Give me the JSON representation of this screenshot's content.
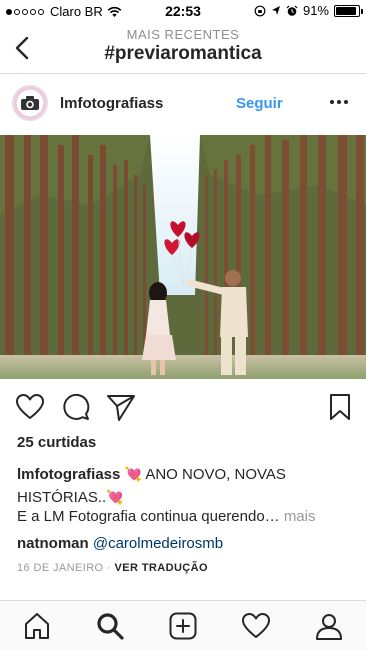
{
  "status_bar": {
    "carrier": "Claro BR",
    "time": "22:53",
    "battery": "91%",
    "battery_level": 0.91,
    "signal_dots_filled": 1,
    "signal_dots_total": 5
  },
  "nav": {
    "subtitle": "MAIS RECENTES",
    "title": "#previaromantica"
  },
  "post": {
    "username": "lmfotografiass",
    "follow_label": "Seguir",
    "likes": "25 curtidas",
    "caption": {
      "username": "lmfotografiass",
      "emoji": "💘",
      "text_line1": "ANO NOVO, NOVAS",
      "text_line2": "HISTÓRIAS..",
      "emoji2": "💘",
      "text_line3": "E a LM Fotografia continua querendo…",
      "more": "mais"
    },
    "comment": {
      "username": "natnoman",
      "mention": "@carolmedeirosmb"
    },
    "date": "16 DE JANEIRO",
    "separator": "·",
    "translate": "VER TRADUÇÃO"
  },
  "colors": {
    "link_blue": "#3897f0",
    "mention_blue": "#003569",
    "muted": "#999999",
    "text": "#262626",
    "divider": "#dbdbdb"
  },
  "icons": {
    "back": "chevron-left-icon",
    "more": "ellipsis-icon",
    "like": "heart-icon",
    "comment": "comment-icon",
    "share": "send-icon",
    "save": "bookmark-icon",
    "home": "home-icon",
    "search": "search-icon",
    "add": "add-post-icon",
    "activity": "activity-heart-icon",
    "profile": "profile-icon"
  }
}
